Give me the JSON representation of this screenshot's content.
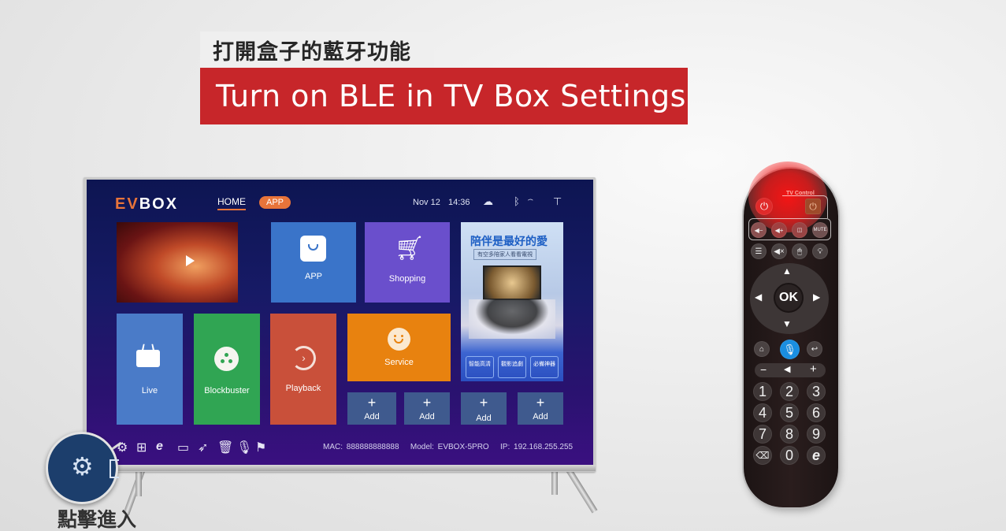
{
  "titles": {
    "chinese": "打開盒子的藍牙功能",
    "english": "Turn on BLE in TV Box Settings"
  },
  "tv": {
    "logo_ev": "EV",
    "logo_box": "BOX",
    "nav": {
      "home": "HOME",
      "app": "APP"
    },
    "status": {
      "date": "Nov 12",
      "time": "14:36"
    },
    "status_icons": [
      "cloud-icon",
      "bluetooth-icon",
      "wifi-icon",
      "network-icon"
    ],
    "tiles": {
      "featured_video": {
        "icon": "play-icon"
      },
      "app": {
        "label": "APP"
      },
      "shopping": {
        "label": "Shopping"
      },
      "promo": {
        "headline": "陪伴是最好的愛",
        "subline": "有空多陪家人看看電視",
        "badges": [
          "智能高清",
          "觀影追劇",
          "必備神器"
        ]
      },
      "live": {
        "label": "Live"
      },
      "blockbuster": {
        "label": "Blockbuster"
      },
      "playback": {
        "label": "Playback"
      },
      "service": {
        "label": "Service"
      },
      "add": [
        "Add",
        "Add",
        "Add",
        "Add"
      ]
    },
    "toolbar_icons": [
      "settings-icon",
      "apps-grid-icon",
      "browser-icon",
      "folder-icon",
      "rocket-icon",
      "trash-icon",
      "mic-icon",
      "flag-icon"
    ],
    "info": {
      "mac": "MAC: 888888888888",
      "model": "Model: EVBOX-5PRO",
      "ip": "IP: 192.168.255.255"
    },
    "tile_colors": {
      "app": "#3a74c9",
      "shopping": "#6a4fcc",
      "live": "#4a7bc8",
      "blockbuster": "#30a553",
      "playback": "#c9503a",
      "service": "#e8820f",
      "add": "#3f5a8e",
      "accent": "#e8743a"
    }
  },
  "callout": {
    "label": "點擊進入",
    "icon": "settings-icon"
  },
  "remote": {
    "tv_control_label": "TV Control",
    "top_row": [
      "power-icon",
      "tv-power-icon"
    ],
    "tv_row": [
      "vol-down-icon",
      "vol-up-icon",
      "tv-input-icon",
      "mute-icon"
    ],
    "func_row": [
      "menu-icon",
      "mute-icon",
      "mouse-icon",
      "light-icon"
    ],
    "ok_label": "OK",
    "nav_row": [
      "home-icon",
      "voice-mic-icon",
      "back-icon"
    ],
    "volume": {
      "minus": "−",
      "plus": "+"
    },
    "numbers": [
      "1",
      "2",
      "3",
      "4",
      "5",
      "6",
      "7",
      "8",
      "9",
      "⌫",
      "0",
      "e"
    ]
  }
}
